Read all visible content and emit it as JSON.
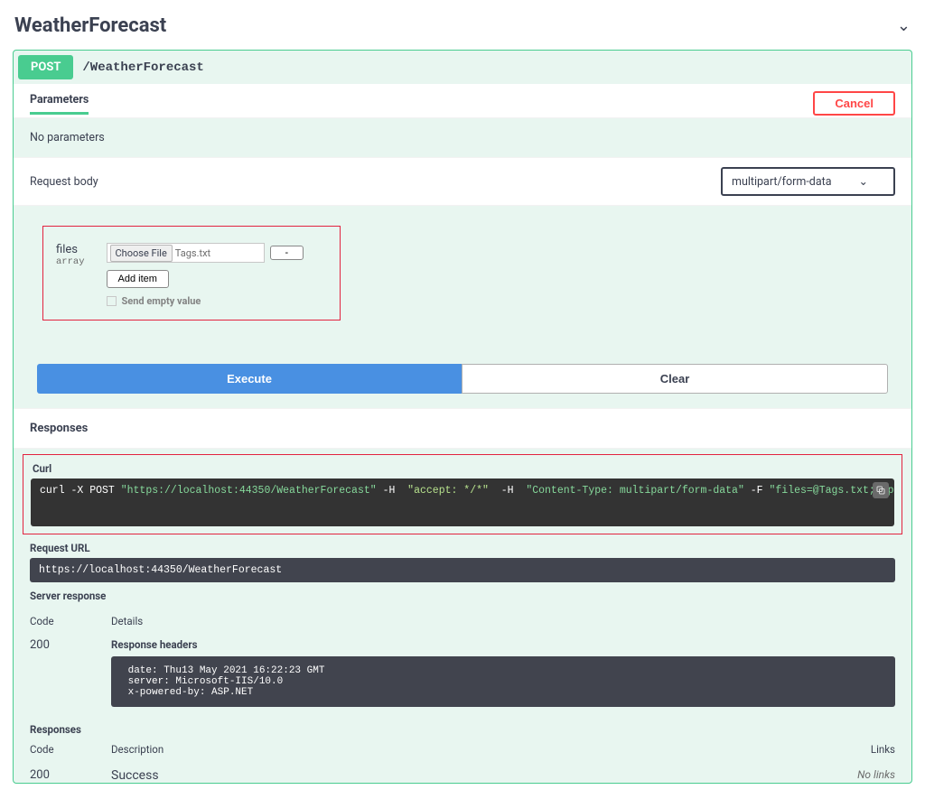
{
  "header": {
    "title": "WeatherForecast"
  },
  "operation": {
    "method": "POST",
    "path": "/WeatherForecast",
    "parameters_label": "Parameters",
    "cancel_label": "Cancel",
    "no_parameters": "No parameters",
    "request_body_label": "Request body",
    "content_type": "multipart/form-data"
  },
  "files_param": {
    "name": "files",
    "type": "array",
    "choose_file_label": "Choose File",
    "selected_file": "Tags.txt",
    "remove_label": "-",
    "add_item_label": "Add item",
    "send_empty_label": "Send empty value"
  },
  "buttons": {
    "execute": "Execute",
    "clear": "Clear"
  },
  "responses_label": "Responses",
  "curl": {
    "label": "Curl",
    "prefix": "curl -X POST ",
    "url": "\"https://localhost:44350/WeatherForecast\"",
    "h1_flag": " -H ",
    "h1_val": " \"accept: */*\" ",
    "h2_flag": " -H ",
    "h2_val": " \"Content-Type: multipart/form-data\" ",
    "f_flag": "-F ",
    "f_val": "\"files=@Tags.txt;type=text/plain\""
  },
  "request_url": {
    "label": "Request URL",
    "value": "https://localhost:44350/WeatherForecast"
  },
  "server_response": {
    "label": "Server response",
    "code_header": "Code",
    "details_header": "Details",
    "code": "200",
    "headers_label": "Response headers",
    "headers": " date: Thu13 May 2021 16:22:23 GMT \n server: Microsoft-IIS/10.0 \n x-powered-by: ASP.NET "
  },
  "documented": {
    "label": "Responses",
    "code_header": "Code",
    "desc_header": "Description",
    "links_header": "Links",
    "code": "200",
    "desc": "Success",
    "no_links": "No links"
  }
}
